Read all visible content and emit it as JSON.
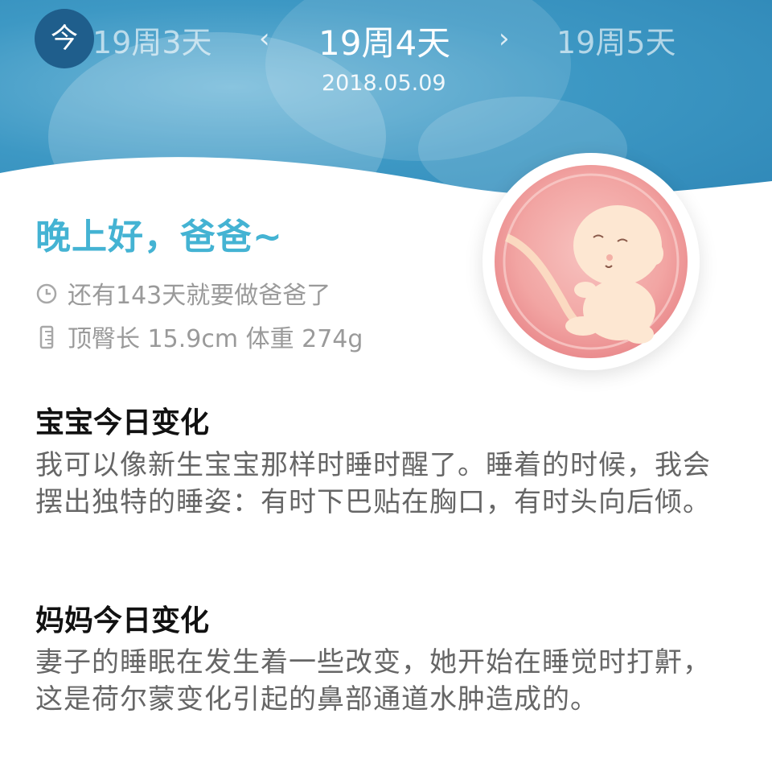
{
  "nav": {
    "today_label": "今",
    "prev_week": "19周3天",
    "current_week": "19周4天",
    "next_week": "19周5天",
    "prev_chevron": "‹",
    "next_chevron": "›",
    "date": "2018.05.09"
  },
  "greeting": "晚上好，爸爸~",
  "info": {
    "countdown": "还有143天就要做爸爸了",
    "measurements": "顶臀长 15.9cm  体重 274g",
    "countdown_icon": "clock-icon",
    "measurement_icon": "ruler-icon"
  },
  "baby_section": {
    "title": "宝宝今日变化",
    "body": "我可以像新生宝宝那样时睡时醒了。睡着的时候，我会摆出独特的睡姿：有时下巴贴在胸口，有时头向后倾。"
  },
  "mom_section": {
    "title": "妈妈今日变化",
    "body": "妻子的睡眠在发生着一些改变，她开始在睡觉时打鼾，这是荷尔蒙变化引起的鼻部通道水肿造成的。"
  },
  "colors": {
    "accent": "#44b3d3",
    "header": "#3d98c4",
    "badge": "#1f5e8c"
  }
}
